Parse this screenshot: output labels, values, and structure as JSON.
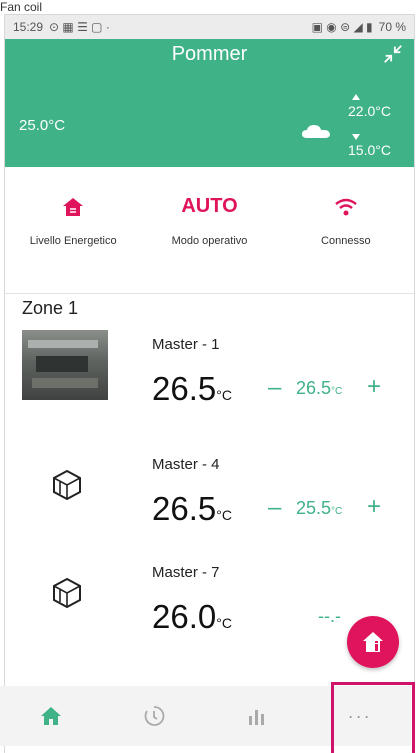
{
  "crop_label": "Fan coil",
  "statusbar": {
    "time": "15:29",
    "right_text": "70 %"
  },
  "header": {
    "title": "Pommer",
    "outdoor_temp": "25.0°C",
    "forecast_max": "22.0°C",
    "forecast_min": "15.0°C",
    "icons": [
      "collapse-icon",
      "cloud-icon"
    ]
  },
  "modes": [
    {
      "icon": "house-energy-icon",
      "label": "Livello Energetico"
    },
    {
      "text": "AUTO",
      "label": "Modo operativo"
    },
    {
      "icon": "wifi-icon",
      "label": "Connesso"
    }
  ],
  "zone": {
    "title": "Zone 1",
    "devices": [
      {
        "name": "Master - 1",
        "temp": "26.5",
        "temp_unit": "°C",
        "setpoint": "26.5",
        "setpoint_unit": "°C",
        "image": "photo"
      },
      {
        "name": "Master - 4",
        "temp": "26.5",
        "temp_unit": "°C",
        "setpoint": "25.5",
        "setpoint_unit": "°C",
        "image": "device-icon"
      },
      {
        "name": "Master - 7",
        "temp": "26.0",
        "temp_unit": "°C",
        "setpoint": "--.-",
        "setpoint_unit": "",
        "image": "device-icon"
      }
    ]
  },
  "bottom_nav": [
    {
      "icon": "home-icon",
      "active": true
    },
    {
      "icon": "schedule-icon",
      "active": false
    },
    {
      "icon": "stats-icon",
      "active": false
    },
    {
      "icon": "more-icon",
      "label": "···",
      "active": false
    }
  ],
  "colors": {
    "primary": "#3fb287",
    "accent": "#e0145c",
    "highlight": "#d0126a"
  }
}
